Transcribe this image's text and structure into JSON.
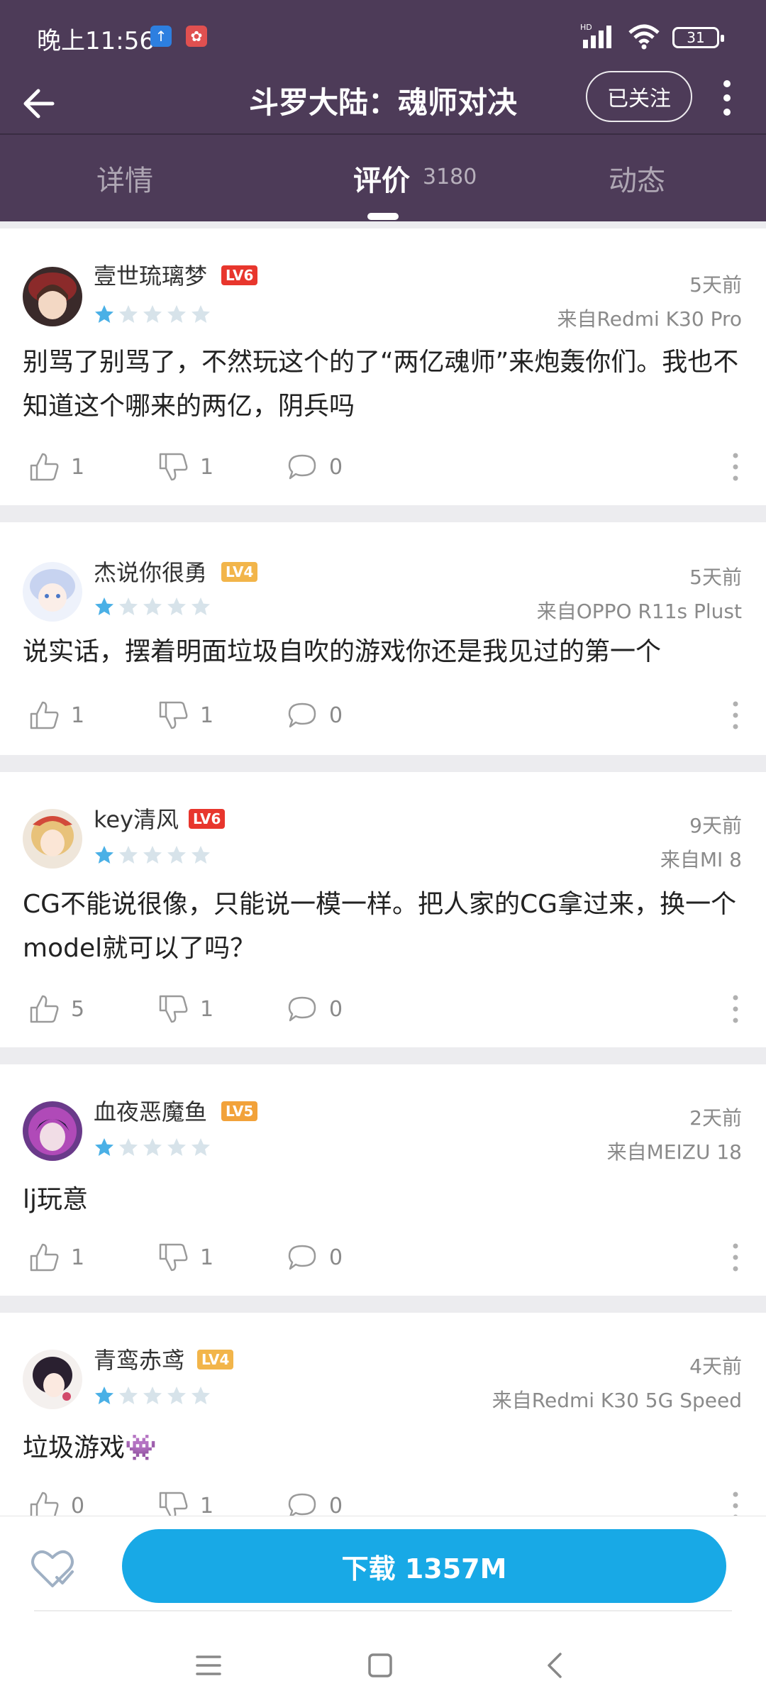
{
  "status_bar": {
    "time": "晚上11:56",
    "battery": "31"
  },
  "nav": {
    "title": "斗罗大陆：魂师对决",
    "follow_label": "已关注"
  },
  "tabs": [
    {
      "label": "详情"
    },
    {
      "label": "评价",
      "count": "3180",
      "active": true
    },
    {
      "label": "动态"
    }
  ],
  "reviews": [
    {
      "username": "壹世琉璃梦",
      "level": "LV6",
      "level_color": "#e8362d",
      "rating": 1,
      "time": "5天前",
      "device": "来自Redmi K30 Pro",
      "content": "别骂了别骂了，不然玩这个的了“两亿魂师”来炮轰你们。我也不知道这个哪来的两亿，阴兵吗",
      "likes": "1",
      "dislikes": "1",
      "comments": "0"
    },
    {
      "username": "杰说你很勇",
      "level": "LV4",
      "level_color": "#f2b54a",
      "rating": 1,
      "time": "5天前",
      "device": "来自OPPO R11s Plust",
      "content": "说实话，摆着明面垃圾自吹的游戏你还是我见过的第一个",
      "likes": "1",
      "dislikes": "1",
      "comments": "0"
    },
    {
      "username": "key清风",
      "level": "LV6",
      "level_color": "#e8362d",
      "rating": 1,
      "time": "9天前",
      "device": "来自MI 8",
      "content": "CG不能说很像，只能说一模一样。把人家的CG拿过来，换一个model就可以了吗？",
      "likes": "5",
      "dislikes": "1",
      "comments": "0"
    },
    {
      "username": "血夜恶魔鱼",
      "level": "LV5",
      "level_color": "#f2a23a",
      "rating": 1,
      "time": "2天前",
      "device": "来自MEIZU 18",
      "content": "lj玩意",
      "likes": "1",
      "dislikes": "1",
      "comments": "0"
    },
    {
      "username": "青鸾赤鸢",
      "level": "LV4",
      "level_color": "#f2b54a",
      "rating": 1,
      "time": "4天前",
      "device": "来自Redmi K30 5G Speed",
      "content": "垃圾游戏👾",
      "likes": "0",
      "dislikes": "1",
      "comments": "0"
    }
  ],
  "bottom": {
    "download_label": "下载 1357M"
  },
  "colors": {
    "header_bg": "#4d3b58",
    "star_active": "#4ab0e6",
    "star_inactive": "#d7e3ea",
    "download_bg": "#18a9e6"
  },
  "icons": [
    "back-arrow-icon",
    "more-vertical-icon",
    "thumb-up-icon",
    "thumb-down-icon",
    "comment-icon",
    "heart-icon",
    "menu-icon",
    "home-square-icon",
    "back-chevron-icon"
  ]
}
